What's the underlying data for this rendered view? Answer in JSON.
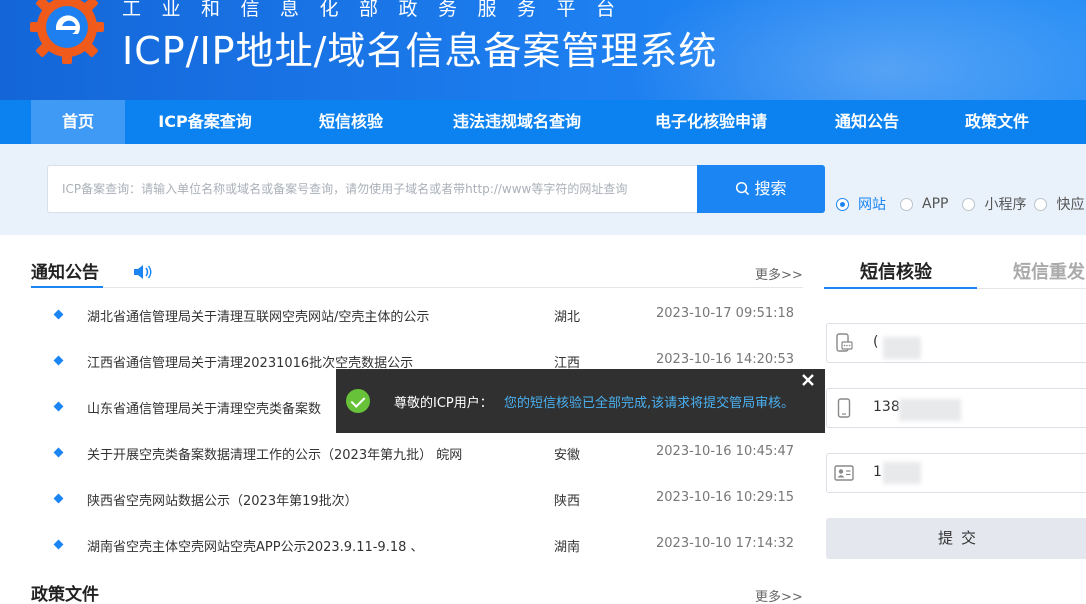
{
  "header": {
    "subtitle": "工业和信息化部政务服务平台",
    "title": "ICP/IP地址/域名信息备案管理系统"
  },
  "nav": {
    "items": [
      "首页",
      "ICP备案查询",
      "短信核验",
      "违法违规域名查询",
      "电子化核验申请",
      "通知公告",
      "政策文件"
    ],
    "active_index": 0
  },
  "search": {
    "placeholder": "ICP备案查询：请输入单位名称或域名或备案号查询，请勿使用子域名或者带http://www等字符的网址查询",
    "button_label": "搜索",
    "types": [
      "网站",
      "APP",
      "小程序",
      "快应"
    ],
    "selected_type": "网站"
  },
  "notices": {
    "title": "通知公告",
    "more_label": "更多>>",
    "rows": [
      {
        "title": "湖北省通信管理局关于清理互联网空壳网站/空壳主体的公示",
        "province": "湖北",
        "time": "2023-10-17 09:51:18"
      },
      {
        "title": "江西省通信管理局关于清理20231016批次空壳数据公示",
        "province": "江西",
        "time": "2023-10-16 14:20:53"
      },
      {
        "title": "山东省通信管理局关于清理空壳类备案数",
        "province": "",
        "time": ""
      },
      {
        "title": "关于开展空壳类备案数据清理工作的公示（2023年第九批） 皖网",
        "province": "安徽",
        "time": "2023-10-16 10:45:47"
      },
      {
        "title": "陕西省空壳网站数据公示（2023年第19批次）",
        "province": "陕西",
        "time": "2023-10-16 10:29:15"
      },
      {
        "title": "湖南省空壳主体空壳网站空壳APP公示2023.9.11-9.18 、",
        "province": "湖南",
        "time": "2023-10-10 17:14:32"
      }
    ]
  },
  "policy": {
    "title": "政策文件",
    "more_label": "更多>>"
  },
  "sms_panel": {
    "tab_active": "短信核验",
    "tab_inactive": "短信重发",
    "field1_value": "(",
    "field2_value": "138",
    "field3_value": "1",
    "submit_label": "提交"
  },
  "toast": {
    "label": "尊敬的ICP用户：",
    "message": "您的短信核验已全部完成,该请求将提交管局审核。"
  },
  "colors": {
    "brand_blue": "#1b85f4",
    "nav_blue": "#0b82f0",
    "success_green": "#67c23a"
  }
}
